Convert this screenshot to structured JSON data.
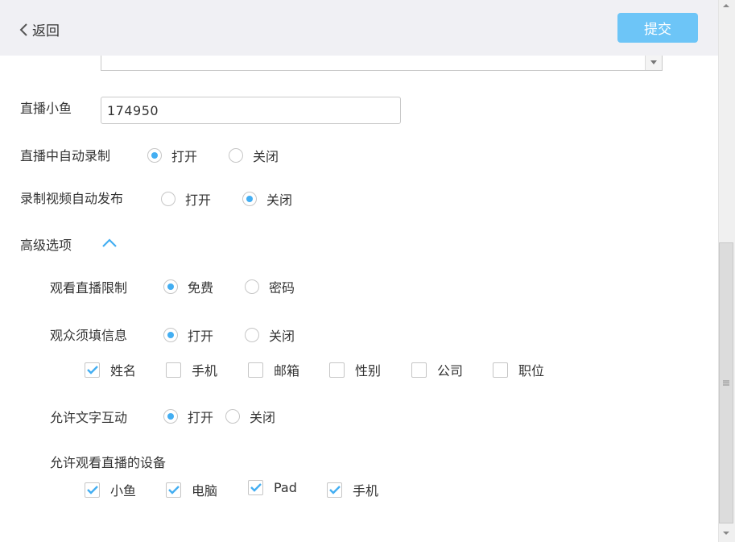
{
  "header": {
    "back_label": "返回",
    "submit_label": "提交"
  },
  "form": {
    "fish_label": "直播小鱼",
    "fish_value": "174950",
    "auto_record": {
      "label": "直播中自动录制",
      "on": "打开",
      "off": "关闭",
      "selected": "on"
    },
    "auto_publish": {
      "label": "录制视频自动发布",
      "on": "打开",
      "off": "关闭",
      "selected": "off"
    }
  },
  "advanced": {
    "label": "高级选项",
    "watch_limit": {
      "label": "观看直播限制",
      "free": "免费",
      "password": "密码",
      "selected": "free"
    },
    "audience_info": {
      "label": "观众须填信息",
      "on": "打开",
      "off": "关闭",
      "selected": "on",
      "fields": [
        {
          "label": "姓名",
          "checked": true
        },
        {
          "label": "手机",
          "checked": false
        },
        {
          "label": "邮箱",
          "checked": false
        },
        {
          "label": "性别",
          "checked": false
        },
        {
          "label": "公司",
          "checked": false
        },
        {
          "label": "职位",
          "checked": false
        }
      ]
    },
    "text_interaction": {
      "label": "允许文字互动",
      "on": "打开",
      "off": "关闭",
      "selected": "on"
    },
    "devices": {
      "label": "允许观看直播的设备",
      "items": [
        {
          "label": "小鱼",
          "checked": true
        },
        {
          "label": "电脑",
          "checked": true
        },
        {
          "label": "Pad",
          "checked": true
        },
        {
          "label": "手机",
          "checked": true
        }
      ]
    }
  },
  "colors": {
    "accent": "#43aef2",
    "submit_bg": "#6dc5f7",
    "header_bg": "#f0f0f4",
    "text": "#333333"
  },
  "icons": {
    "back": "chevron-left-icon",
    "toggle": "chevron-up-icon",
    "check": "checkmark-icon"
  }
}
